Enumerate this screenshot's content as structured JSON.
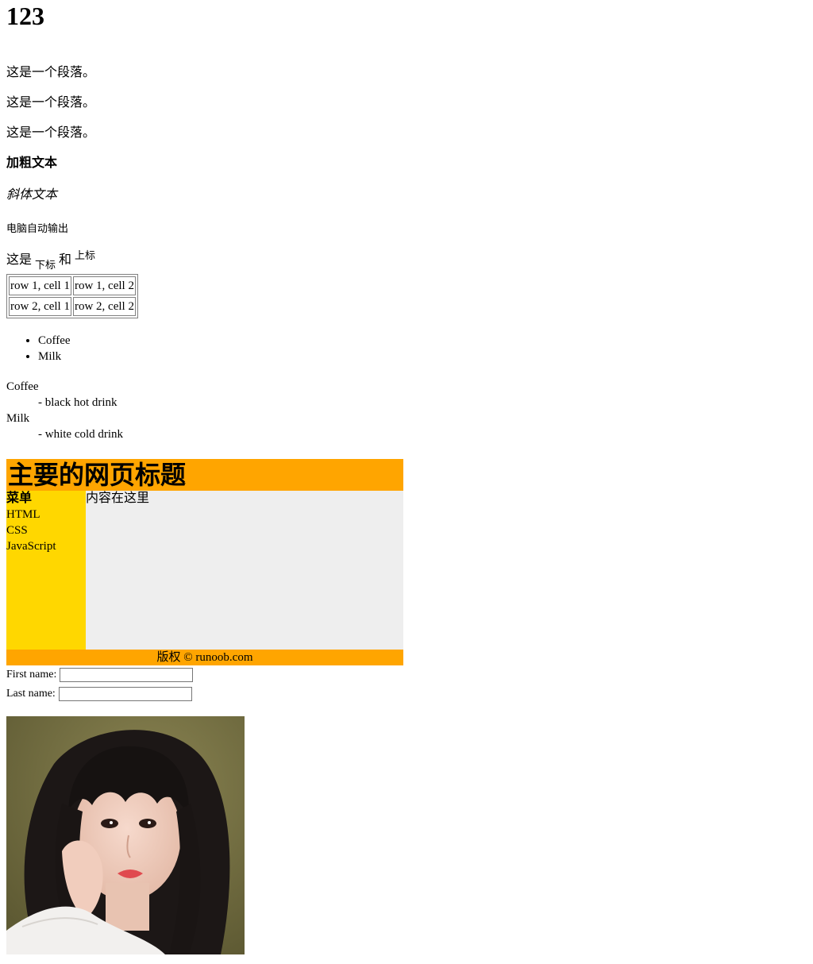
{
  "heading": "123",
  "paragraphs": [
    "这是一个段落。",
    "这是一个段落。",
    "这是一个段落。"
  ],
  "bold_text": "加粗文本",
  "italic_text": "斜体文本",
  "code_text": "电脑自动输出",
  "subsup": {
    "prefix": "这是",
    "sub": "下标",
    "middle": "和",
    "sup": "上标"
  },
  "table": {
    "rows": [
      [
        "row 1, cell 1",
        "row 1, cell 2"
      ],
      [
        "row 2, cell 1",
        "row 2, cell 2"
      ]
    ]
  },
  "unordered_list": [
    "Coffee",
    "Milk"
  ],
  "definition_list": [
    {
      "term": "Coffee",
      "desc": "- black hot drink"
    },
    {
      "term": "Milk",
      "desc": "- white cold drink"
    }
  ],
  "layout": {
    "header_title": "主要的网页标题",
    "menu_title": "菜单",
    "menu_items": [
      "HTML",
      "CSS",
      "JavaScript"
    ],
    "content": "内容在这里",
    "footer": "版权 © runoob.com",
    "colors": {
      "header": "#FFA500",
      "menu": "#FFD700",
      "content": "#EEEEEE",
      "footer": "#FFA500"
    }
  },
  "form": {
    "first_label": "First name:",
    "first_value": "",
    "last_label": "Last name:",
    "last_value": ""
  }
}
